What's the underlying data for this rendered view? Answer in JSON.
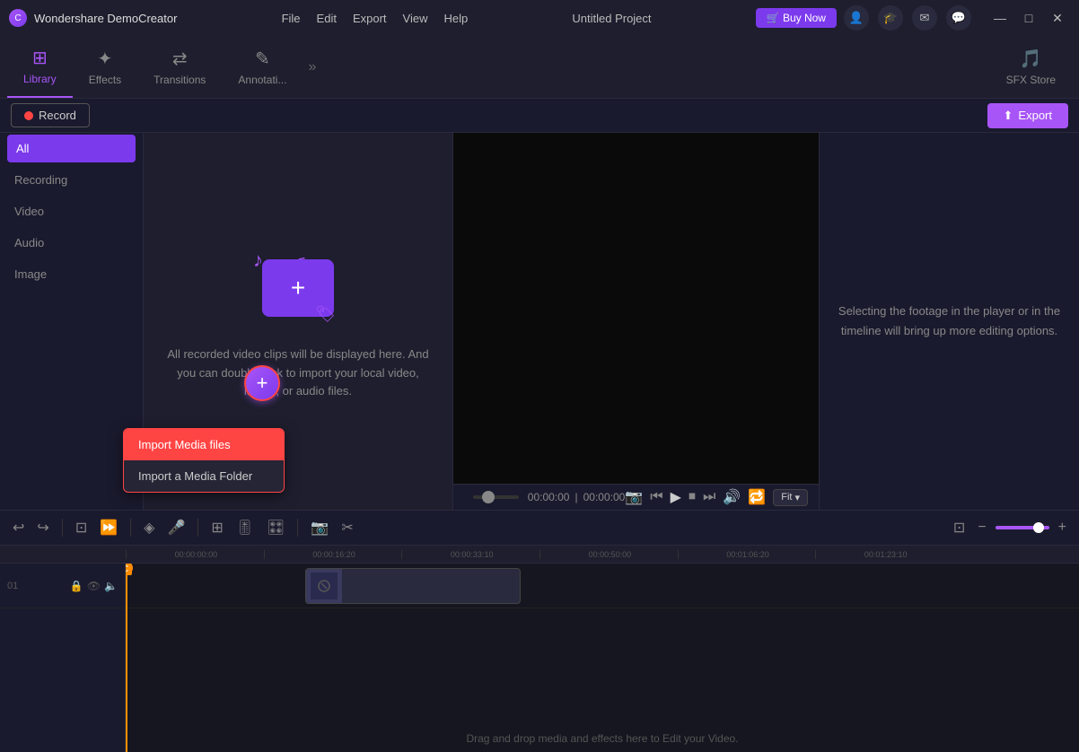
{
  "app": {
    "name": "Wondershare DemoCreator",
    "project_title": "Untitled Project"
  },
  "menu": {
    "items": [
      "File",
      "Edit",
      "Export",
      "View",
      "Help"
    ]
  },
  "titlebar": {
    "buy_now": "🛒 Buy Now",
    "minimize": "—",
    "maximize": "□",
    "close": "✕"
  },
  "tabs": [
    {
      "id": "library",
      "label": "Library",
      "icon": "⊞",
      "active": true
    },
    {
      "id": "effects",
      "label": "Effects",
      "icon": "✨",
      "active": false
    },
    {
      "id": "transitions",
      "label": "Transitions",
      "icon": "⇄",
      "active": false
    },
    {
      "id": "annotations",
      "label": "Annotati...",
      "icon": "✏️",
      "active": false
    },
    {
      "id": "sfxstore",
      "label": "SFX Store",
      "icon": "🎵",
      "active": false
    }
  ],
  "sidebar": {
    "items": [
      {
        "id": "all",
        "label": "All",
        "active": true
      },
      {
        "id": "recording",
        "label": "Recording",
        "active": false
      },
      {
        "id": "video",
        "label": "Video",
        "active": false
      },
      {
        "id": "audio",
        "label": "Audio",
        "active": false
      },
      {
        "id": "image",
        "label": "Image",
        "active": false
      }
    ]
  },
  "media": {
    "empty_text": "All recorded video clips will be displayed here. And you can double-click to import your local video, image, or audio files.",
    "folder_plus": "+",
    "music_note1": "♪",
    "music_note2": "♫",
    "tag_icon": "🏷"
  },
  "record": {
    "label": "Record",
    "dot": "●"
  },
  "export": {
    "label": "Export",
    "icon": "⬆"
  },
  "preview": {
    "time_current": "00:00:00",
    "time_separator": "|",
    "time_total": "00:00:00",
    "fit_label": "Fit",
    "chevron": "▾"
  },
  "info_panel": {
    "text": "Selecting the footage in the player or in the timeline will bring up more editing options."
  },
  "toolbar": {
    "undo": "↩",
    "redo": "↪",
    "crop": "⊡",
    "speed": "⏩",
    "mark": "◈",
    "mic": "🎤",
    "multi": "⊞",
    "audio_adj": "🎚",
    "split": "⋮",
    "snapshot": "📷",
    "voice": "🎙",
    "zoom_in": "+",
    "zoom_out": "−"
  },
  "dropdown": {
    "items": [
      {
        "id": "import-media",
        "label": "Import Media files",
        "active": true
      },
      {
        "id": "import-folder",
        "label": "Import a Media Folder",
        "active": false
      }
    ]
  },
  "timeline": {
    "ruler_marks": [
      "00:00:00:00",
      "00:00:16:20",
      "00:00:33:10",
      "00:00:50:00",
      "00:01:06:20",
      "00:01:23:10"
    ],
    "tracks": [
      {
        "number": "01",
        "icons": [
          "🔒",
          "👁",
          "🔈"
        ]
      }
    ],
    "drag_text": "Drag and drop media and effects here to Edit your Video.",
    "playhead_label": "C"
  }
}
